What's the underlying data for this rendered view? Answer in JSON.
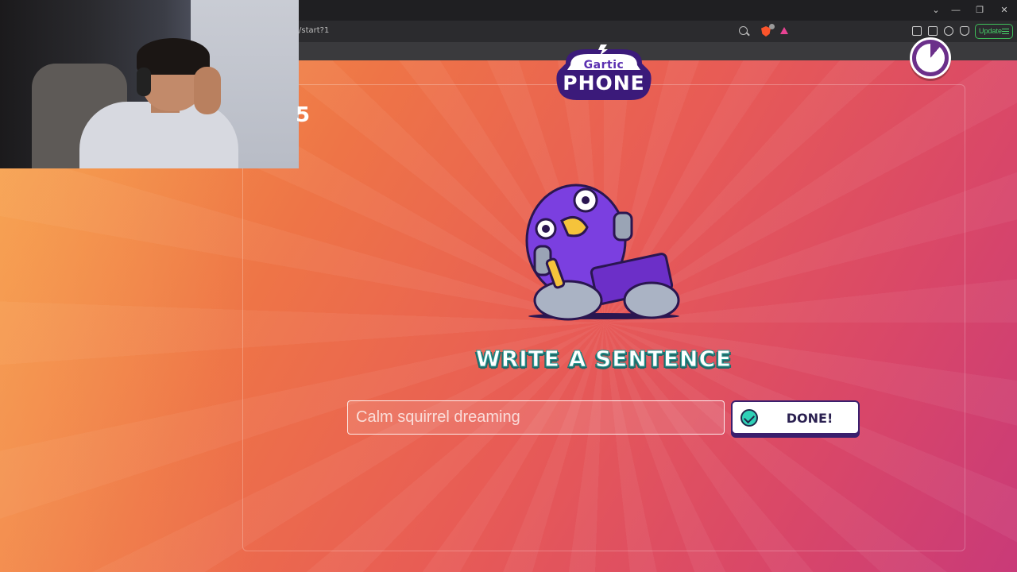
{
  "browser": {
    "url_fragment": "/start?1",
    "update_label": "Update",
    "window_controls": [
      "chevron-down",
      "minimize",
      "restore",
      "close"
    ]
  },
  "game": {
    "logo_top": "Gartic",
    "logo_bottom": "PHONE",
    "prompt_title": "WRITE A SENTENCE",
    "input_value": "Calm squirrel dreaming",
    "done_label": "DONE!",
    "timer_remaining_fraction": 0.89,
    "partial_left_text": "5"
  },
  "colors": {
    "bg_orange": "#f5a049",
    "bg_pink": "#c93a78",
    "prompt_title_accent": "#2a9a94",
    "done_check": "#2fd1b7",
    "timer_purple": "#6b2f8a",
    "update_green": "#48d36a"
  }
}
